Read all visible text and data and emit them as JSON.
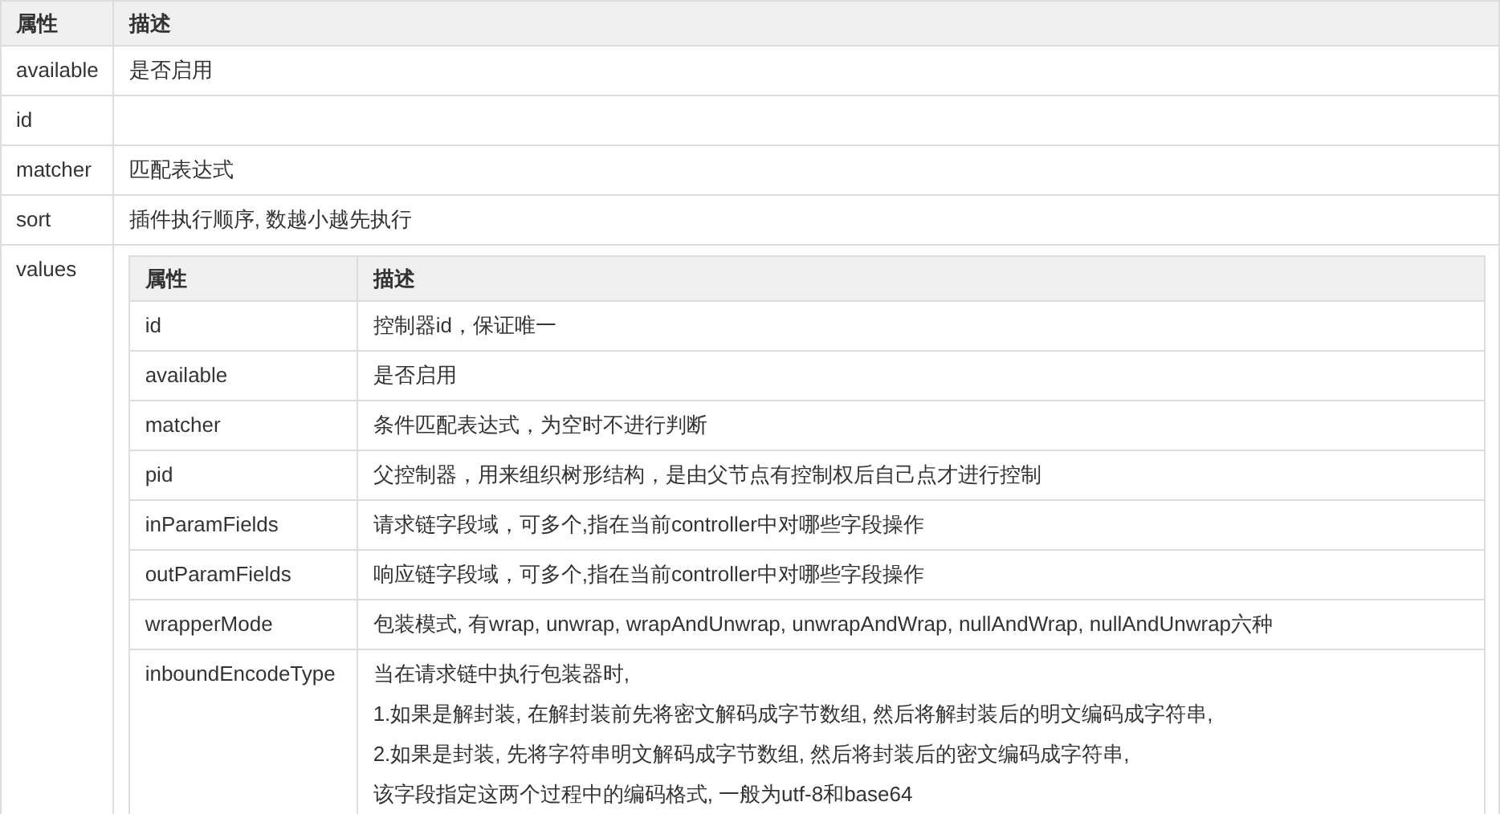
{
  "table": {
    "columns": [
      "属性",
      "描述"
    ],
    "rows": [
      {
        "name": "available",
        "description": [
          "是否启用"
        ]
      },
      {
        "name": "id",
        "description": []
      },
      {
        "name": "matcher",
        "description": [
          "匹配表达式"
        ]
      },
      {
        "name": "sort",
        "description": [
          "插件执行顺序, 数越小越先执行"
        ]
      },
      {
        "name": "values",
        "nested_table": {
          "columns": [
            "属性",
            "描述"
          ],
          "rows": [
            {
              "name": "id",
              "description": [
                "控制器id，保证唯一"
              ]
            },
            {
              "name": "available",
              "description": [
                "是否启用"
              ]
            },
            {
              "name": "matcher",
              "description": [
                "条件匹配表达式，为空时不进行判断"
              ]
            },
            {
              "name": "pid",
              "description": [
                "父控制器，用来组织树形结构，是由父节点有控制权后自己点才进行控制"
              ]
            },
            {
              "name": "inParamFields",
              "description": [
                "请求链字段域，可多个,指在当前controller中对哪些字段操作"
              ]
            },
            {
              "name": "outParamFields",
              "description": [
                "响应链字段域，可多个,指在当前controller中对哪些字段操作"
              ]
            },
            {
              "name": "wrapperMode",
              "description": [
                "包装模式, 有wrap, unwrap, wrapAndUnwrap, unwrapAndWrap, nullAndWrap, nullAndUnwrap六种"
              ]
            },
            {
              "name": "inboundEncodeType",
              "description": [
                "当在请求链中执行包装器时,",
                "1.如果是解封装, 在解封装前先将密文解码成字节数组, 然后将解封装后的明文编码成字符串,",
                "2.如果是封装, 先将字符串明文解码成字节数组, 然后将封装后的密文编码成字符串,",
                "该字段指定这两个过程中的编码格式, 一般为utf-8和base64"
              ]
            }
          ]
        }
      }
    ]
  }
}
